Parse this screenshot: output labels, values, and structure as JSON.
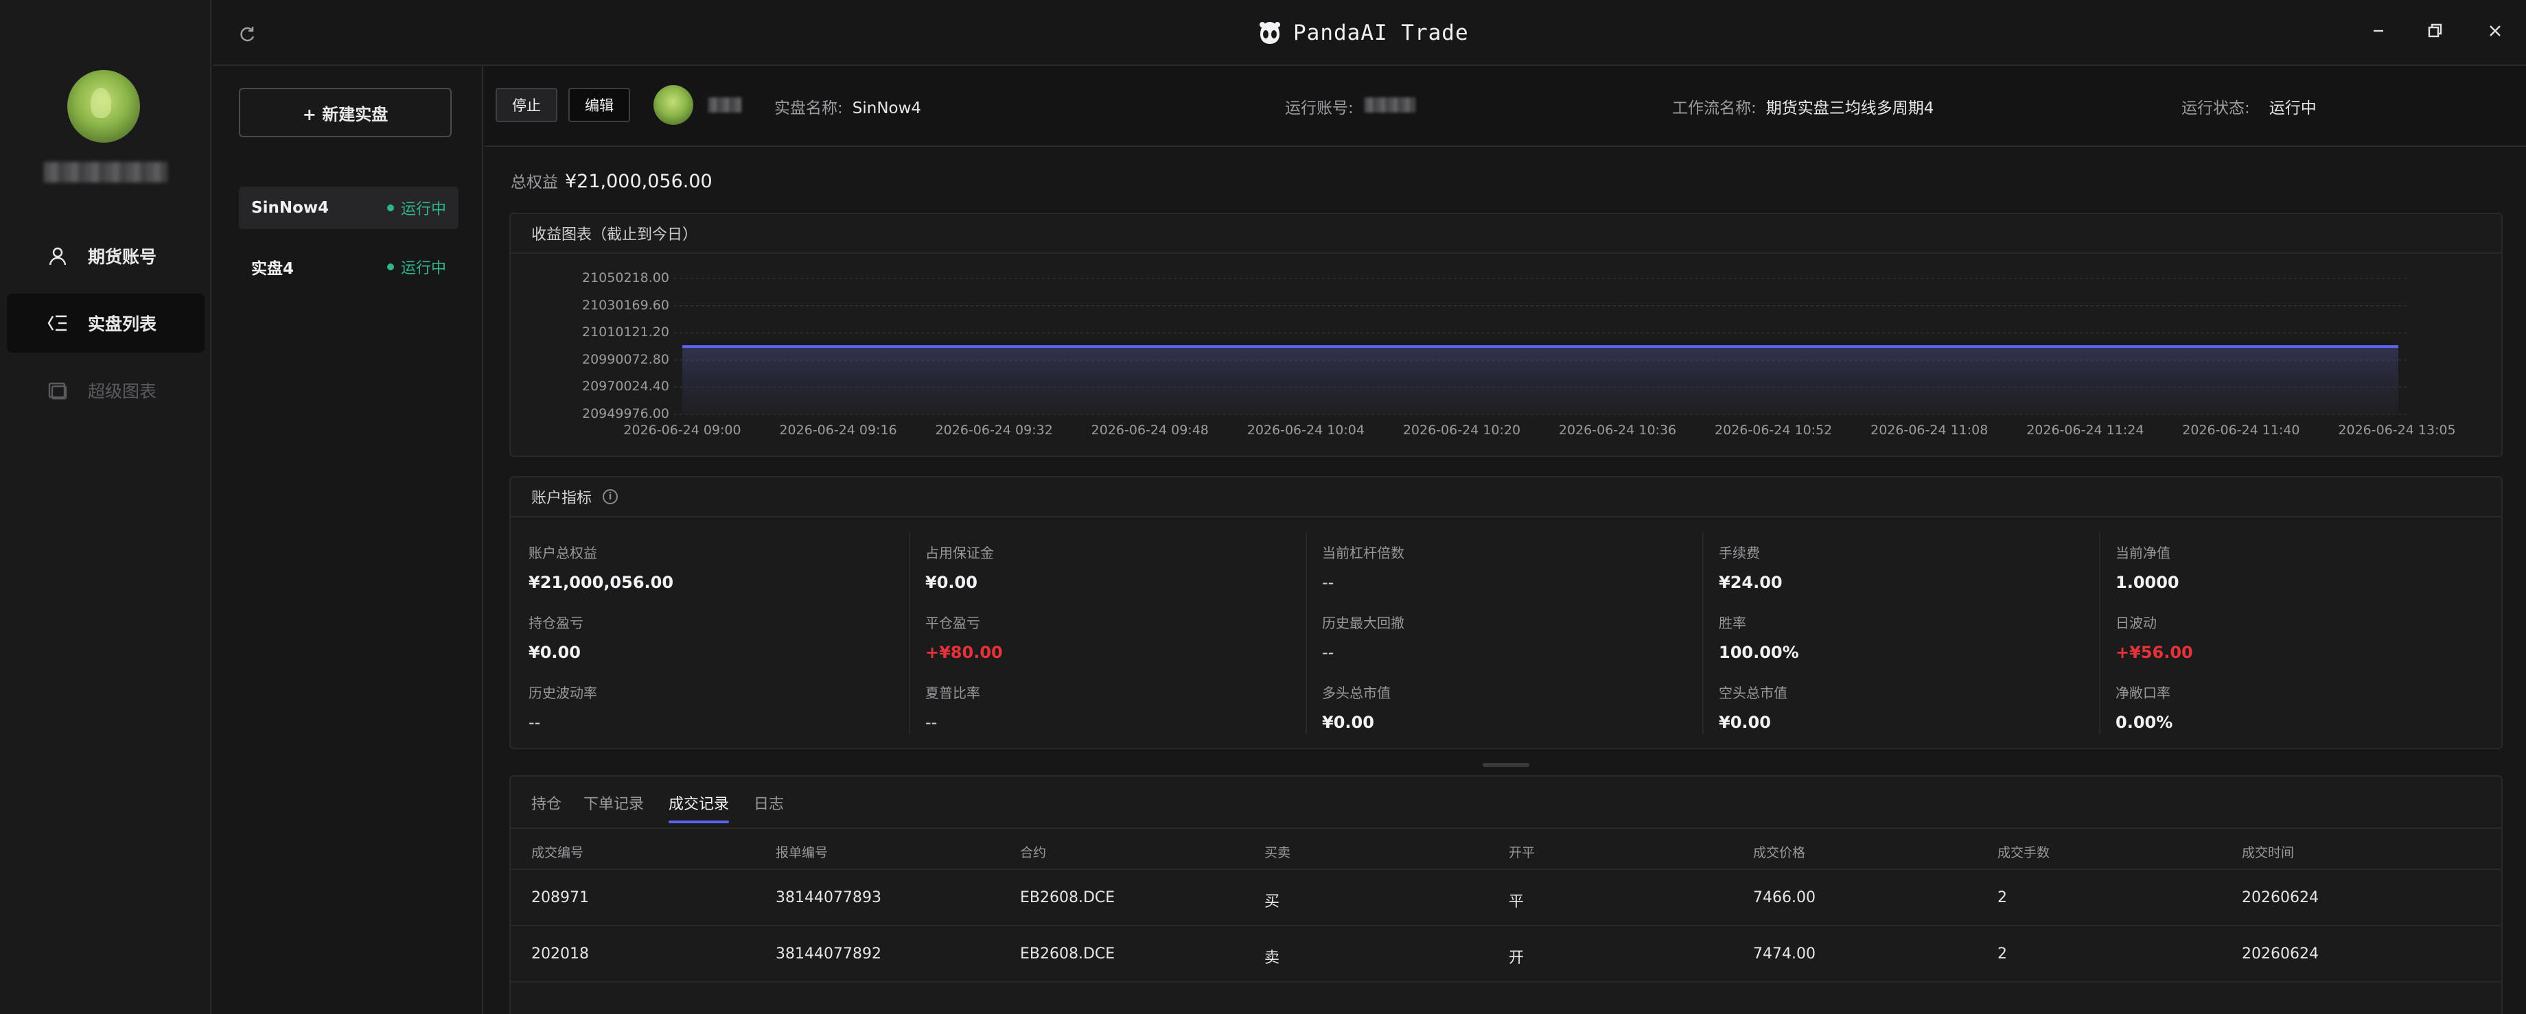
{
  "app": {
    "title": "PandaAI Trade"
  },
  "nav": {
    "items": [
      {
        "label": "期货账号",
        "icon": "user-icon"
      },
      {
        "label": "实盘列表",
        "icon": "list-icon"
      },
      {
        "label": "超级图表",
        "icon": "chart-icon"
      }
    ]
  },
  "strategies": {
    "new_label": "+ 新建实盘",
    "items": [
      {
        "name": "SinNow4",
        "status": "运行中"
      },
      {
        "name": "实盘4",
        "status": "运行中"
      }
    ]
  },
  "detail": {
    "stop_label": "停止",
    "edit_label": "编辑",
    "strategy_name_key": "实盘名称:",
    "strategy_name": "SinNow4",
    "account_key": "运行账号:",
    "workflow_key": "工作流名称:",
    "workflow_name": "期货实盘三均线多周期4",
    "status_key": "运行状态:",
    "status": "运行中"
  },
  "equity": {
    "label": "总权益",
    "value": "¥21,000,056.00"
  },
  "chart_card": {
    "title": "收益图表（截止到今日）"
  },
  "chart_data": {
    "type": "area",
    "title": "",
    "y_ticks": [
      "21050218.00",
      "21030169.60",
      "21010121.20",
      "20990072.80",
      "20970024.40",
      "20949976.00"
    ],
    "x_ticks": [
      "2026-06-24 09:00",
      "2026-06-24 09:16",
      "2026-06-24 09:32",
      "2026-06-24 09:48",
      "2026-06-24 10:04",
      "2026-06-24 10:20",
      "2026-06-24 10:36",
      "2026-06-24 10:52",
      "2026-06-24 11:08",
      "2026-06-24 11:24",
      "2026-06-24 11:40",
      "2026-06-24 13:05"
    ],
    "ylim": [
      20949976.0,
      21050218.0
    ],
    "series": [
      {
        "values": [
          21000056,
          21000056,
          21000056,
          21000056,
          21000056,
          21000056,
          21000056,
          21000056,
          21000056,
          21000056,
          21000056,
          21000056
        ]
      }
    ],
    "grid": true,
    "line_color": "#5a64f0"
  },
  "metrics_card": {
    "title": "账户指标",
    "items": [
      {
        "label": "账户总权益",
        "value": "¥21,000,056.00",
        "tone": "normal"
      },
      {
        "label": "占用保证金",
        "value": "¥0.00",
        "tone": "normal"
      },
      {
        "label": "当前杠杆倍数",
        "value": "--",
        "tone": "dash"
      },
      {
        "label": "手续费",
        "value": "¥24.00",
        "tone": "normal"
      },
      {
        "label": "当前净值",
        "value": "1.0000",
        "tone": "normal"
      },
      {
        "label": "持仓盈亏",
        "value": "¥0.00",
        "tone": "normal"
      },
      {
        "label": "平仓盈亏",
        "value": "+¥80.00",
        "tone": "red"
      },
      {
        "label": "历史最大回撤",
        "value": "--",
        "tone": "dash"
      },
      {
        "label": "胜率",
        "value": "100.00%",
        "tone": "normal"
      },
      {
        "label": "日波动",
        "value": "+¥56.00",
        "tone": "red"
      },
      {
        "label": "历史波动率",
        "value": "--",
        "tone": "dash"
      },
      {
        "label": "夏普比率",
        "value": "--",
        "tone": "dash"
      },
      {
        "label": "多头总市值",
        "value": "¥0.00",
        "tone": "normal"
      },
      {
        "label": "空头总市值",
        "value": "¥0.00",
        "tone": "normal"
      },
      {
        "label": "净敞口率",
        "value": "0.00%",
        "tone": "normal"
      }
    ]
  },
  "records": {
    "tabs": [
      "持仓",
      "下单记录",
      "成交记录",
      "日志"
    ],
    "active_tab": "成交记录",
    "columns": [
      "成交编号",
      "报单编号",
      "合约",
      "买卖",
      "开平",
      "成交价格",
      "成交手数",
      "成交时间"
    ],
    "rows": [
      [
        "208971",
        "38144077893",
        "EB2608.DCE",
        "买",
        "平",
        "7466.00",
        "2",
        "20260624"
      ],
      [
        "202018",
        "38144077892",
        "EB2608.DCE",
        "卖",
        "开",
        "7474.00",
        "2",
        "20260624"
      ]
    ]
  },
  "colors": {
    "accent": "#5a64f0",
    "running": "#2fb58d",
    "loss_red": "#e8323a"
  }
}
